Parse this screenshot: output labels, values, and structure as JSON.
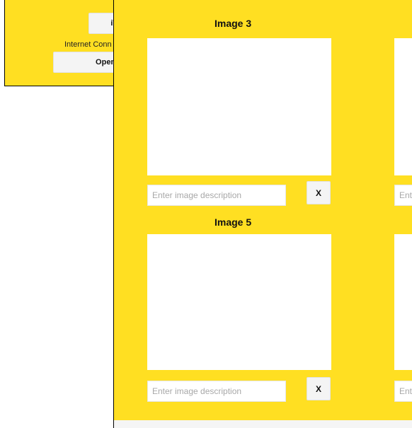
{
  "background_panel": {
    "top_button_label": "iTre",
    "connection_label": "Internet Conn",
    "open_button_label": "Open in"
  },
  "image_panel": {
    "slots": [
      {
        "title": "Image 3",
        "placeholder": "Enter image description",
        "remove_label": "X"
      },
      {
        "title": "",
        "placeholder": "Ent",
        "remove_label": ""
      },
      {
        "title": "Image 5",
        "placeholder": "Enter image description",
        "remove_label": "X"
      },
      {
        "title": "",
        "placeholder": "Ent",
        "remove_label": ""
      }
    ]
  },
  "colors": {
    "panel_yellow": "#FFDF22",
    "button_gray": "#F4F4F4"
  }
}
